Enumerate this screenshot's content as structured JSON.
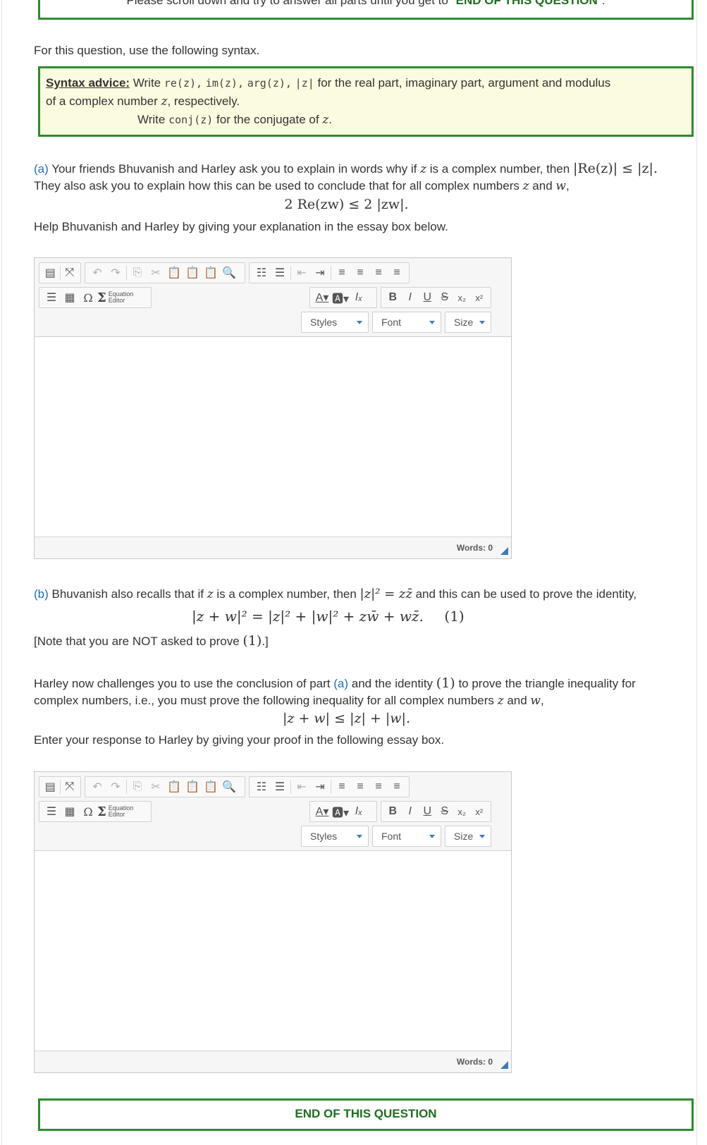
{
  "top_notice": {
    "prefix": "Please scroll down and try to answer all parts until you get to \"",
    "bold": "END OF THIS QUESTION",
    "suffix": "\"."
  },
  "intro": "For this question, use the following syntax.",
  "syntax_advice": {
    "label": "Syntax advice:",
    "write1": " Write ",
    "codes": [
      "re(z),",
      "im(z),",
      "arg(z),",
      "|z|"
    ],
    "text1": " for the real part,  imaginary part, argument and modulus",
    "text2a": "of a complex number ",
    "text2b": ", respectively.",
    "write2": "Write ",
    "conj_code": "conj(z)",
    "text3": " for the conjugate of ",
    "text3end": "."
  },
  "part_a": {
    "label": "(a)",
    "line1": " Your friends Bhuvanish and Harley ask you to explain in words why if ",
    "line1b": " is a complex number, then ",
    "line2": "They also ask you to explain how this can be used to conclude that for all complex numbers ",
    "line2b": " and ",
    "line2c": ",",
    "line3": "Help Bhuvanish and Harley by giving your explanation in the essay box below."
  },
  "part_b": {
    "label": "(b)",
    "line1": " Bhuvanish also recalls that if ",
    "line1b": " is a complex number, then ",
    "line1c": " and this can be used to prove the identity,",
    "note_a": "[Note that you are NOT asked to prove ",
    "note_b": ".]",
    "p2a": "Harley now challenges you to use the conclusion of part ",
    "p2part": "(a)",
    "p2b": " and the identity ",
    "p2c": " to prove the triangle inequality for",
    "p3a": "complex numbers, i.e., you must prove the following inequality for all complex numbers ",
    "p3b": " and ",
    "p3c": ",",
    "p4": "Enter your response to Harley by giving your proof in the following essay box."
  },
  "math": {
    "z": "z",
    "w": "w",
    "ineq_a": "|Re(z)| ≤ |z|.",
    "ineq_a_display": "2 Re(zw) ≤ 2 |zw|.",
    "mod_sq": "|z|² = zz̄",
    "identity": "|z + w|² = |z|² + |w|² + zw̄ + wz̄.",
    "identity_tag": "(1)",
    "tag": "(1)",
    "triangle": "|z + w| ≤ |z| + |w|."
  },
  "editor": {
    "styles_label": "Styles",
    "font_label": "Font",
    "size_label": "Size",
    "equation_label_1": "Equation",
    "equation_label_2": "Editor",
    "words_label": "Words: 0"
  },
  "end_text": "END OF THIS QUESTION",
  "colors": {
    "box_border": "#2e8b2e",
    "syntax_bg": "#fbfbdf",
    "part_label": "#1f6fb5",
    "end_text": "#1d6e1d"
  }
}
